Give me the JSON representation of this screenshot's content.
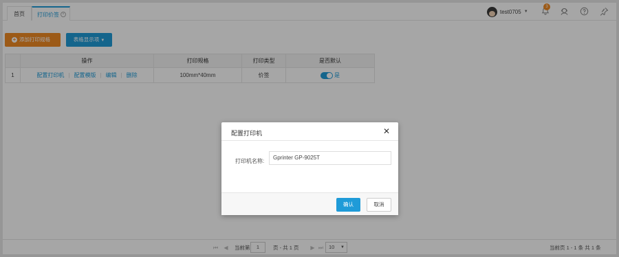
{
  "tabs": {
    "home": "首页",
    "active": "打印价签",
    "close_glyph": "×"
  },
  "user": {
    "name": "test0705",
    "notifications": "3"
  },
  "toolbar": {
    "add_label": "添加打印规格",
    "columns_label": "表格显示项"
  },
  "table": {
    "headers": [
      "操作",
      "打印规格",
      "打印类型",
      "是否默认"
    ],
    "rows": [
      {
        "index": "1",
        "actions": [
          "配置打印机",
          "配置模版",
          "编辑",
          "删除"
        ],
        "spec": "100mm*40mm",
        "type": "价签",
        "default_label": "是",
        "default_on": true
      }
    ]
  },
  "pager": {
    "current_label": "当前第",
    "page": "1",
    "total_pages_text": "页 - 共 1 页",
    "page_size": "10",
    "summary": "当前页 1 - 1 条  共 1 条"
  },
  "modal": {
    "title": "配置打印机",
    "close_glyph": "✕",
    "field_label": "打印机名称:",
    "field_value": "Gprinter GP-9025T",
    "confirm_label": "确认",
    "cancel_label": "取消"
  },
  "colors": {
    "accent": "#1f9bd8",
    "orange": "#f08a24"
  },
  "icons": [
    "avatar",
    "bell-icon",
    "support-icon",
    "help-icon",
    "pin-icon"
  ]
}
